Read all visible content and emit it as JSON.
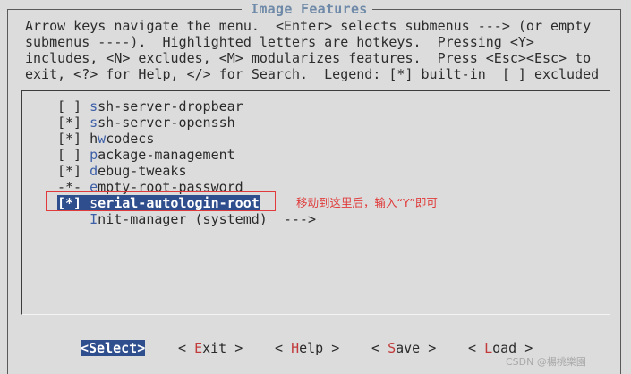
{
  "dialog": {
    "title": "Image Features",
    "help_lines": [
      "Arrow keys navigate the menu.  <Enter> selects submenus ---> (or empty",
      "submenus ----).  Highlighted letters are hotkeys.  Pressing <Y>",
      "includes, <N> excludes, <M> modularizes features.  Press <Esc><Esc> to",
      "exit, <?> for Help, </> for Search.  Legend: [*] built-in  [ ] excluded"
    ]
  },
  "menu": {
    "items": [
      {
        "prefix": "[ ] ",
        "hotkey": "s",
        "rest": "sh-server-dropbear",
        "selected": false
      },
      {
        "prefix": "[*] ",
        "hotkey": "s",
        "rest": "sh-server-openssh",
        "selected": false
      },
      {
        "prefix": "[*] ",
        "hotkey": "h",
        "rest_before": "",
        "hotkey_index": 1,
        "text_full": "hwcodecs",
        "selected": false
      },
      {
        "prefix": "[ ] ",
        "hotkey": "p",
        "rest": "ackage-management",
        "selected": false
      },
      {
        "prefix": "[*] ",
        "hotkey": "d",
        "rest": "ebug-tweaks",
        "selected": false
      },
      {
        "prefix": "-*- ",
        "hotkey": "e",
        "rest": "mpty-root-password",
        "selected": false
      },
      {
        "prefix": "[*] ",
        "hotkey": "s",
        "rest": "erial-autologin-root",
        "selected": true
      },
      {
        "prefix": "    ",
        "hotkey": "I",
        "rest": "nit-manager (systemd)  --->",
        "selected": false
      }
    ]
  },
  "annotation": {
    "text": "移动到这里后，输入“Y”即可",
    "color": "#e03a3a"
  },
  "buttons": {
    "select": "Select",
    "exit_hotkey": "E",
    "exit_rest": "xit",
    "help_hotkey": "H",
    "help_rest": "elp",
    "save_hotkey": "S",
    "save_rest": "ave",
    "load_hotkey": "L",
    "load_rest": "oad"
  },
  "watermark": "CSDN @楊桃樂園",
  "colors": {
    "background": "#dcdcdc",
    "highlight": "#2f4e8e",
    "title": "#6f8aa8",
    "annotation": "#e03a3a"
  }
}
